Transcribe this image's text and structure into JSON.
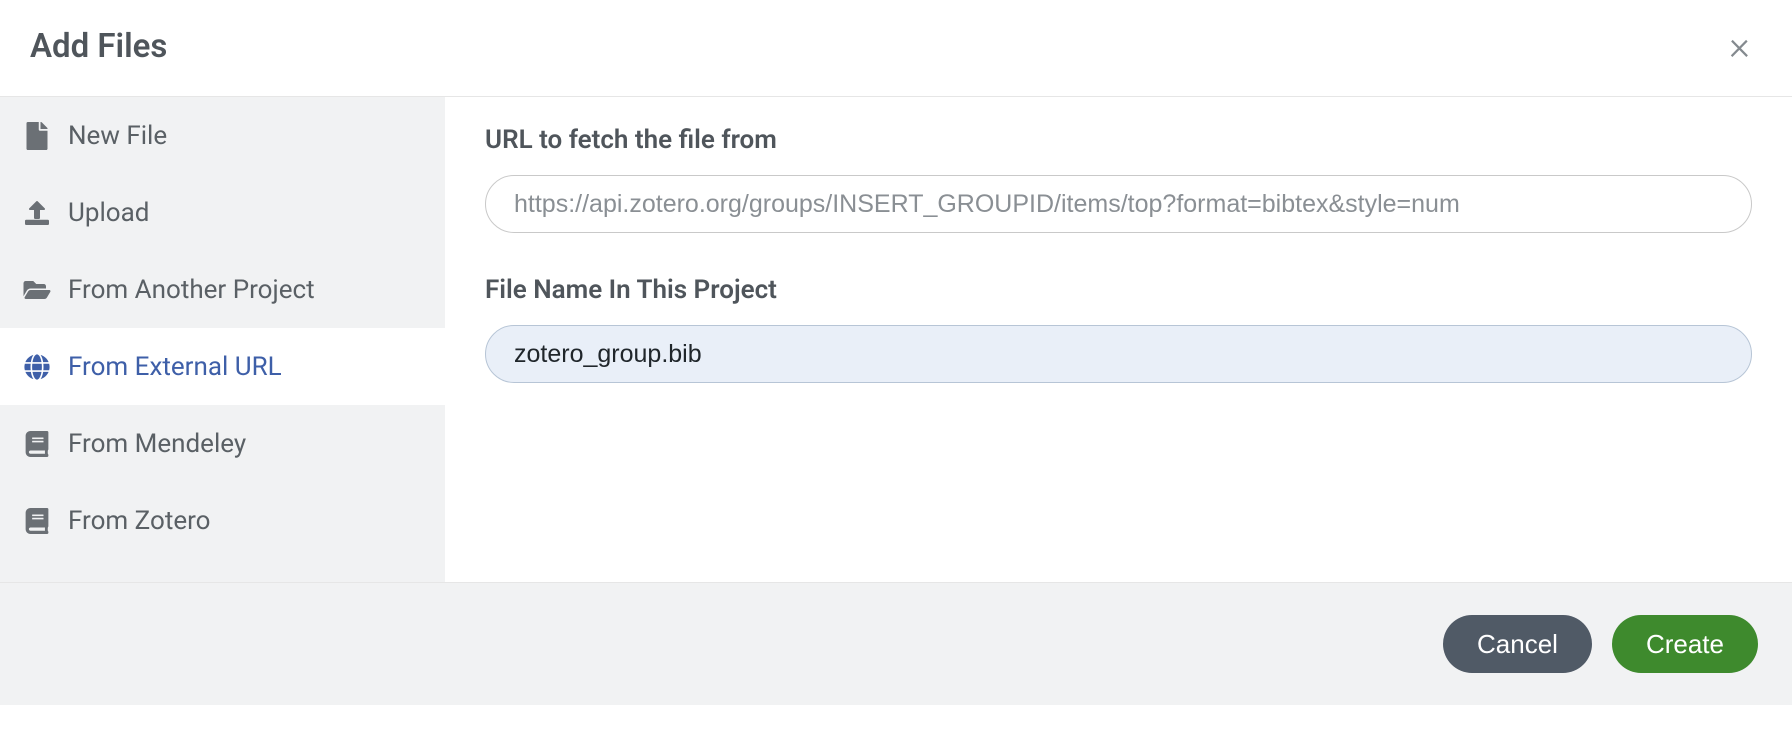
{
  "header": {
    "title": "Add Files"
  },
  "sidebar": {
    "items": [
      {
        "label": "New File",
        "icon": "file-icon",
        "active": false
      },
      {
        "label": "Upload",
        "icon": "upload-icon",
        "active": false
      },
      {
        "label": "From Another Project",
        "icon": "folder-open-icon",
        "active": false
      },
      {
        "label": "From External URL",
        "icon": "globe-icon",
        "active": true
      },
      {
        "label": "From Mendeley",
        "icon": "book-icon",
        "active": false
      },
      {
        "label": "From Zotero",
        "icon": "book-icon",
        "active": false
      }
    ]
  },
  "form": {
    "url_label": "URL to fetch the file from",
    "url_placeholder": "https://api.zotero.org/groups/INSERT_GROUPID/items/top?format=bibtex&style=num",
    "filename_label": "File Name In This Project",
    "filename_value": "zotero_group.bib"
  },
  "footer": {
    "cancel_label": "Cancel",
    "create_label": "Create"
  },
  "colors": {
    "accent": "#3e5fa8",
    "create": "#3e8a2d",
    "cancel": "#505a66"
  }
}
